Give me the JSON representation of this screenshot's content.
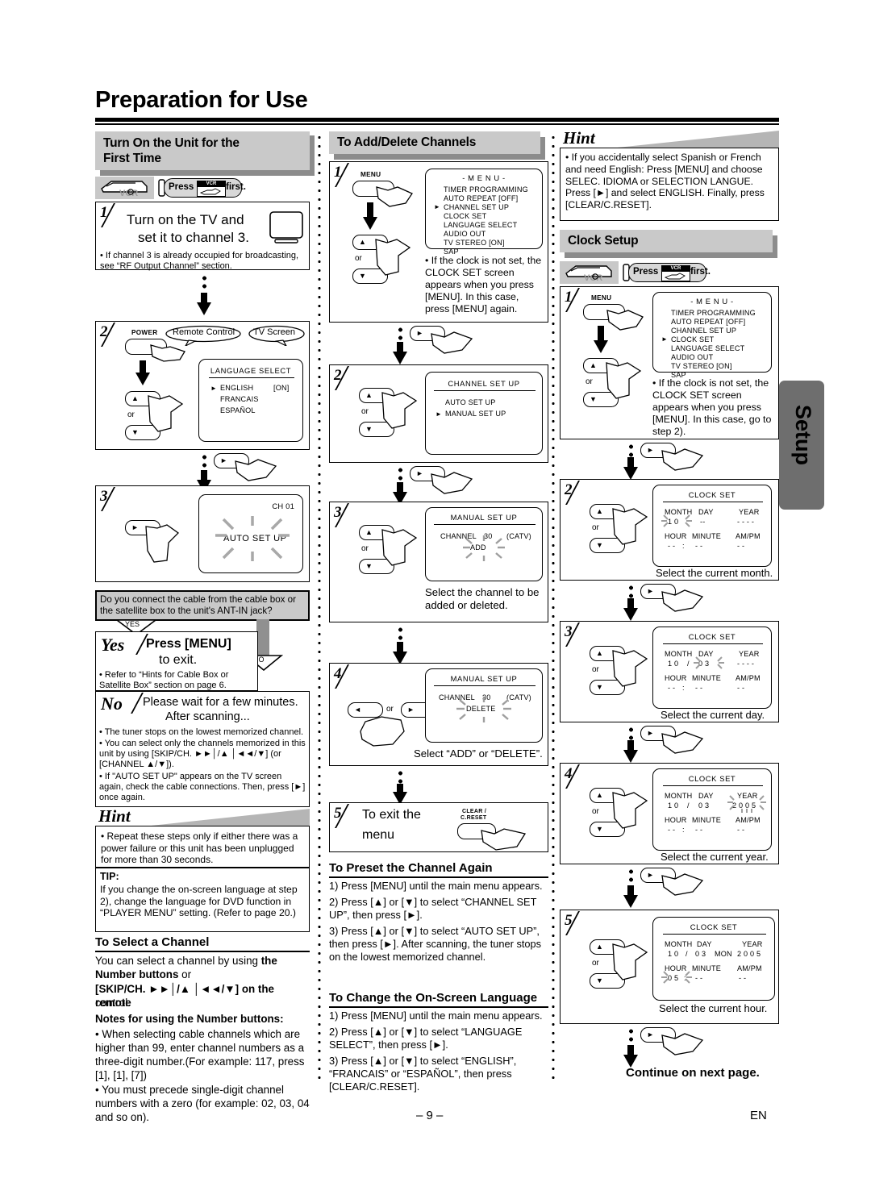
{
  "page": {
    "title": "Preparation for Use",
    "page_number": "– 9 –",
    "lang_code": "EN",
    "side_tab": "Setup",
    "continue_note": "Continue on next page."
  },
  "left_column": {
    "section_title_line1": "Turn On the Unit for the",
    "section_title_line2": "First Time",
    "press_badge": {
      "press": "Press",
      "vcr": "VCR",
      "first": "first."
    },
    "step1": {
      "num": "1",
      "line1": "Turn on the TV and",
      "line2": "set it to channel 3.",
      "note": "• If channel 3 is already occupied for broadcasting, see “RF Output Channel” section."
    },
    "step2": {
      "num": "2",
      "power_label": "POWER",
      "callout_remote": "Remote Control",
      "callout_tv": "TV Screen",
      "or": "or",
      "osd": {
        "title": "LANGUAGE SELECT",
        "items": [
          "ENGLISH",
          "FRANCAIS",
          "ESPAÑOL"
        ],
        "english_state": "[ON]"
      }
    },
    "step3": {
      "num": "3",
      "osd_channel": "CH 01",
      "osd_text": "AUTO SET UP"
    },
    "question": "Do you connect the cable from the cable box or the satellite box to the unit's ANT-IN jack?",
    "yes_label": "YES",
    "no_label": "NO",
    "yes_box": {
      "word": "Yes",
      "line1": "Press [MENU]",
      "line2": "to exit.",
      "note": "• Refer to “Hints for Cable Box or Satellite Box” section on page 6."
    },
    "no_box": {
      "word": "No",
      "line1": "Please wait for a few minutes.",
      "line2": "After scanning...",
      "bullets": [
        "• The tuner stops on the lowest memorized channel.",
        "• You can select only the channels memorized in this unit by using [SKIP/CH. ►►│/▲ │◄◄/▼] (or [CHANNEL ▲/▼]).",
        "• If \"AUTO SET UP\" appears on the TV screen again, check the cable connections. Then, press [►] once again."
      ]
    },
    "hint": {
      "word": "Hint",
      "text": "• Repeat these steps only if either there was a power failure or this unit has been unplugged for more than 30 seconds."
    },
    "tip": {
      "label": "TIP:",
      "text": "If you change the on-screen language at step 2), change the language for DVD function in “PLAYER MENU” setting. (Refer to page 20.)"
    },
    "select_channel": {
      "heading": "To Select a Channel",
      "p1_a": "You can select a channel by using ",
      "p1_b": "the Number buttons",
      "p1_c": " or",
      "p2": "[SKIP/CH. ►►│/▲ │◄◄/▼] on the remote",
      "p3": "control.",
      "notes_heading": "Notes for using the Number buttons:",
      "note1": "• When selecting cable channels which are higher than 99, enter channel numbers as a three-digit number.(For example: 117, press [1], [1], [7])",
      "note2": "• You must precede single-digit channel numbers with a zero (for example: 02, 03, 04 and so on)."
    }
  },
  "middle_column": {
    "section_title": "To Add/Delete Channels",
    "step1": {
      "num": "1",
      "menu_label": "MENU",
      "or": "or",
      "osd": {
        "title": "- M E N U -",
        "items": [
          "TIMER PROGRAMMING",
          "AUTO REPEAT   [OFF]",
          "CHANNEL SET UP",
          "CLOCK SET",
          "LANGUAGE SELECT",
          "AUDIO OUT",
          "TV STEREO         [ON]",
          "SAP"
        ],
        "cursor_index": 2
      },
      "note": "• If the clock is not set, the CLOCK SET screen appears when you press [MENU]. In this case, press [MENU] again."
    },
    "step2": {
      "num": "2",
      "or": "or",
      "osd": {
        "title": "CHANNEL SET UP",
        "items": [
          "AUTO SET UP",
          "MANUAL SET UP"
        ],
        "cursor_index": 1
      }
    },
    "step3": {
      "num": "3",
      "or": "or",
      "osd": {
        "title": "MANUAL SET UP",
        "channel_label": "CHANNEL",
        "channel_value": "30",
        "catv": "(CATV)",
        "action": "ADD"
      },
      "caption": "Select the channel to be added or deleted."
    },
    "step4": {
      "num": "4",
      "or": "or",
      "osd": {
        "title": "MANUAL SET UP",
        "channel_label": "CHANNEL",
        "channel_value": "30",
        "catv": "(CATV)",
        "action": "DELETE"
      },
      "caption": "Select “ADD” or “DELETE”."
    },
    "step5": {
      "num": "5",
      "line1": "To exit the",
      "line2": "menu",
      "button_label_1": "CLEAR /",
      "button_label_2": "C.RESET"
    },
    "preset": {
      "heading": "To Preset the Channel Again",
      "items": [
        "1) Press [MENU] until the main menu appears.",
        "2) Press [▲] or [▼] to select “CHANNEL SET UP”, then press [►].",
        "3) Press [▲] or [▼] to select “AUTO SET UP”, then press [►]. After scanning, the tuner stops on the lowest memorized channel."
      ]
    },
    "language": {
      "heading": "To Change the On-Screen Language",
      "items": [
        "1) Press [MENU] until the main menu appears.",
        "2) Press [▲] or [▼] to select “LANGUAGE SELECT”, then press [►].",
        "3) Press [▲] or [▼] to select “ENGLISH”, “FRANCAIS” or “ESPAÑOL”, then press [CLEAR/C.RESET]."
      ]
    }
  },
  "right_column": {
    "hint": {
      "word": "Hint",
      "text": "• If you accidentally select Spanish or French and need English: Press [MENU] and choose SELEC. IDIOMA or SELECTION LANGUE. Press [►] and select ENGLISH. Finally, press [CLEAR/C.RESET]."
    },
    "section_title": "Clock Setup",
    "press_badge": {
      "press": "Press",
      "vcr": "VCR",
      "first": "first."
    },
    "step1": {
      "num": "1",
      "menu_label": "MENU",
      "or": "or",
      "osd": {
        "title": "- M E N U -",
        "items": [
          "TIMER PROGRAMMING",
          "AUTO REPEAT   [OFF]",
          "CHANNEL SET UP",
          "CLOCK SET",
          "LANGUAGE SELECT",
          "AUDIO OUT",
          "TV STEREO         [ON]",
          "SAP"
        ],
        "cursor_index": 3
      },
      "note": "• If the clock is not set, the CLOCK SET screen appears when you press [MENU]. In this case, go to step 2)."
    },
    "clock_headers": {
      "month": "MONTH",
      "day": "DAY",
      "year": "YEAR",
      "hour": "HOUR",
      "minute": "MINUTE",
      "ampm": "AM/PM"
    },
    "step2": {
      "num": "2",
      "or": "or",
      "osd_title": "CLOCK SET",
      "month": "1 0",
      "day": "--",
      "year": "- - - -",
      "hour": "- -",
      "minute": "- -",
      "ampm": "- -",
      "caption": "Select the current month."
    },
    "step3": {
      "num": "3",
      "or": "or",
      "osd_title": "CLOCK SET",
      "month": "1 0",
      "day": "0 3",
      "year": "- - - -",
      "hour": "- -",
      "minute": "- -",
      "ampm": "- -",
      "caption": "Select the current day."
    },
    "step4": {
      "num": "4",
      "or": "or",
      "osd_title": "CLOCK SET",
      "month": "1 0",
      "day": "0 3",
      "year": "2 0 0 5",
      "hour": "- -",
      "minute": "- -",
      "ampm": "- -",
      "caption": "Select the current year."
    },
    "step5": {
      "num": "5",
      "or": "or",
      "osd_title": "CLOCK SET",
      "month": "1 0",
      "day": "0 3",
      "weekday": "MON",
      "year": "2 0 0 5",
      "hour": "0 5",
      "minute": "- -",
      "ampm": "- -",
      "caption": "Select the current hour."
    }
  },
  "colors": {
    "header_grey": "#c9c9c9",
    "shadow_grey": "#8c8c8c",
    "tab_grey": "#6e6e6e",
    "blink_grey": "#a8a8a8"
  }
}
